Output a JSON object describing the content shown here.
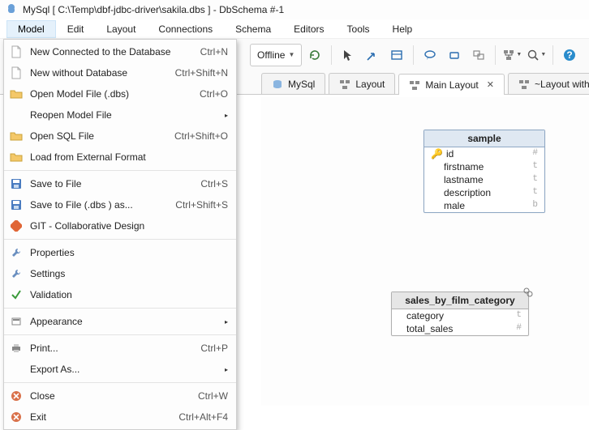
{
  "title": "MySql [ C:\\Temp\\dbf-jdbc-driver\\sakila.dbs ] - DbSchema #-1",
  "menubar": {
    "items": [
      "Model",
      "Edit",
      "Layout",
      "Connections",
      "Schema",
      "Editors",
      "Tools",
      "Help"
    ],
    "active_index": 0
  },
  "toolbar": {
    "offline_dd": "Offline"
  },
  "tabs": [
    {
      "label": "MySql",
      "active": false,
      "closable": false,
      "icon": "db"
    },
    {
      "label": "Layout",
      "active": false,
      "closable": false,
      "icon": "layout"
    },
    {
      "label": "Main Layout",
      "active": true,
      "closable": true,
      "icon": "layout"
    },
    {
      "label": "~Layout with S",
      "active": false,
      "closable": false,
      "icon": "layout"
    }
  ],
  "dropdown": {
    "groups": [
      [
        {
          "icon": "doc",
          "label": "New Connected to the Database",
          "accel": "Ctrl+N"
        },
        {
          "icon": "doc",
          "label": "New without Database",
          "accel": "Ctrl+Shift+N"
        },
        {
          "icon": "folder",
          "label": "Open Model File (.dbs)",
          "accel": "Ctrl+O"
        },
        {
          "icon": "",
          "label": "Reopen Model File",
          "accel": "",
          "submenu": true
        },
        {
          "icon": "folder",
          "label": "Open SQL File",
          "accel": "Ctrl+Shift+O"
        },
        {
          "icon": "folder",
          "label": "Load from External Format",
          "accel": ""
        }
      ],
      [
        {
          "icon": "save",
          "label": "Save to File",
          "accel": "Ctrl+S"
        },
        {
          "icon": "save",
          "label": "Save to File (.dbs ) as...",
          "accel": "Ctrl+Shift+S"
        },
        {
          "icon": "git",
          "label": "GIT - Collaborative Design",
          "accel": ""
        }
      ],
      [
        {
          "icon": "wrench",
          "label": "Properties",
          "accel": ""
        },
        {
          "icon": "wrench",
          "label": "Settings",
          "accel": ""
        },
        {
          "icon": "check",
          "label": "Validation",
          "accel": ""
        }
      ],
      [
        {
          "icon": "appear",
          "label": "Appearance",
          "accel": "",
          "submenu": true
        }
      ],
      [
        {
          "icon": "print",
          "label": "Print...",
          "accel": "Ctrl+P"
        },
        {
          "icon": "",
          "label": "Export As...",
          "accel": "",
          "submenu": true
        }
      ],
      [
        {
          "icon": "closex",
          "label": "Close",
          "accel": "Ctrl+W"
        },
        {
          "icon": "closex",
          "label": "Exit",
          "accel": "Ctrl+Alt+F4"
        }
      ]
    ]
  },
  "entities": {
    "sample": {
      "title": "sample",
      "rows": [
        {
          "name": "id",
          "type": "#",
          "key": true
        },
        {
          "name": "firstname",
          "type": "t"
        },
        {
          "name": "lastname",
          "type": "t"
        },
        {
          "name": "description",
          "type": "t"
        },
        {
          "name": "male",
          "type": "b"
        }
      ]
    },
    "sales": {
      "title": "sales_by_film_category",
      "rows": [
        {
          "name": "category",
          "type": "t"
        },
        {
          "name": "total_sales",
          "type": "#"
        }
      ]
    }
  }
}
